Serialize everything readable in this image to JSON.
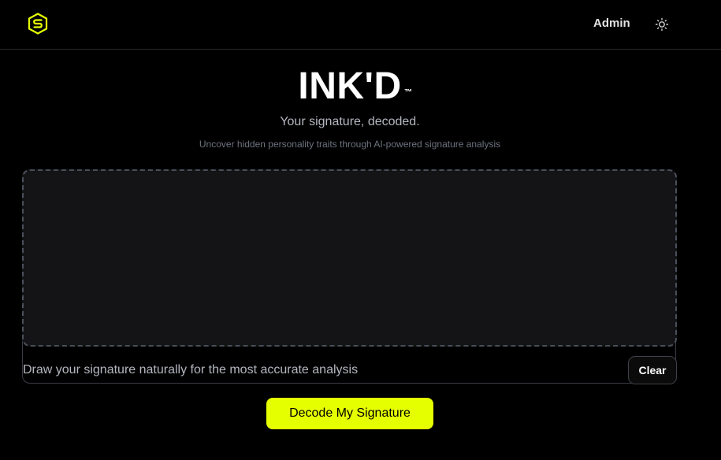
{
  "header": {
    "logo_icon": "hexagon-s-logo-icon",
    "admin_label": "Admin",
    "theme_icon": "sun-icon"
  },
  "hero": {
    "title": "INK'D",
    "trademark": "™",
    "tagline": "Your signature, decoded.",
    "subtitle": "Uncover hidden personality traits through AI-powered signature analysis"
  },
  "signature_pad": {
    "hint": "Draw your signature naturally for the most accurate analysis",
    "clear_label": "Clear"
  },
  "actions": {
    "decode_label": "Decode My Signature"
  },
  "colors": {
    "accent": "#e6ff00",
    "background": "#000000",
    "canvas": "#141416",
    "muted_text": "#b4b7bf"
  }
}
